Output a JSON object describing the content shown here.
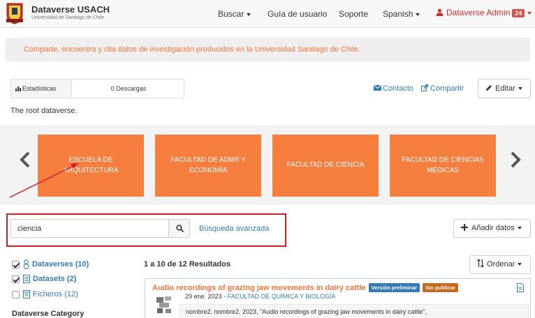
{
  "nav": {
    "brand": "Dataverse USACH",
    "brand_sub": "Universidad de Santiago de Chile",
    "search": "Buscar",
    "guide": "Guía de usuario",
    "support": "Soporte",
    "language": "Spanish",
    "user": "Dataverse Admin",
    "notifications": "24"
  },
  "banner": "Comparte, encuentra y cita datos de investigación producidos en la Universidad Santiago de Chile.",
  "stats": {
    "label": "Estadísticas",
    "downloads": "0 Descargas"
  },
  "actions": {
    "contact": "Contacto",
    "share": "Compartir",
    "edit": "Editar"
  },
  "root_description": "The root dataverse.",
  "carousel": {
    "cards": [
      {
        "label": "ESCUELA DE ARQUITECTURA"
      },
      {
        "label": "FACULTAD DE ADMS Y ECONOMÍA"
      },
      {
        "label": "FACULTAD DE CIENCIA"
      },
      {
        "label": "FACULTAD DE CIENCIAS MÉDICAS"
      }
    ]
  },
  "search": {
    "value": "ciencia",
    "advanced": "Búsqueda avanzada",
    "add_data": "Añadir datos"
  },
  "facets": {
    "dataverses": "Dataverses (10)",
    "datasets": "Datasets (2)",
    "files": "Ficheros (12)",
    "category_heading": "Dataverse Category"
  },
  "results": {
    "count": "1 a 10 de 12 Resultados",
    "sort": "Ordenar"
  },
  "result_item": {
    "title": "Audio recordings of grazing jaw movements in dairy cattle",
    "tag_draft": "Versión preliminar",
    "tag_unpublished": "Sin publicar",
    "date": "29 ene. 2023",
    "faculty": "FACULTAD DE QUÍMICA Y BIOLOGÍA",
    "citation": "nombre2, nombre2, 2023, \"Audio recordings of grazing jaw movements in dairy cattle\","
  },
  "colors": {
    "accent_orange": "#f67e3f",
    "link_blue": "#337ab7",
    "annotation_red": "#d21c2a",
    "tag_blue": "#337ab7",
    "tag_brown": "#c36a1d"
  },
  "icons": {
    "stats": "bar-chart-icon",
    "contact": "envelope-icon",
    "share": "share-icon",
    "edit": "pencil-icon",
    "search": "magnifier-icon",
    "add": "plus-icon",
    "sort": "sort-icon",
    "dataverse": "dataverse-icon",
    "dataset": "dataset-icon",
    "file": "file-icon"
  }
}
